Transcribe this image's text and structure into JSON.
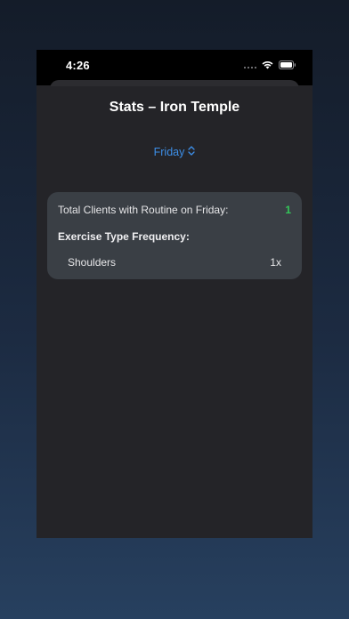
{
  "status_bar": {
    "time": "4:26"
  },
  "header": {
    "title": "Stats – Iron Temple"
  },
  "picker": {
    "selected": "Friday",
    "icon": "chevron-up-down-icon"
  },
  "stats": {
    "total_label": "Total Clients with Routine on Friday:",
    "total_value": "1",
    "frequency_heading": "Exercise Type Frequency:",
    "frequencies": [
      {
        "name": "Shoulders",
        "count": "1x"
      }
    ]
  },
  "colors": {
    "accent": "#3d8fe8",
    "success": "#34c759",
    "card": "#3a3f45",
    "sheet": "#242428"
  }
}
